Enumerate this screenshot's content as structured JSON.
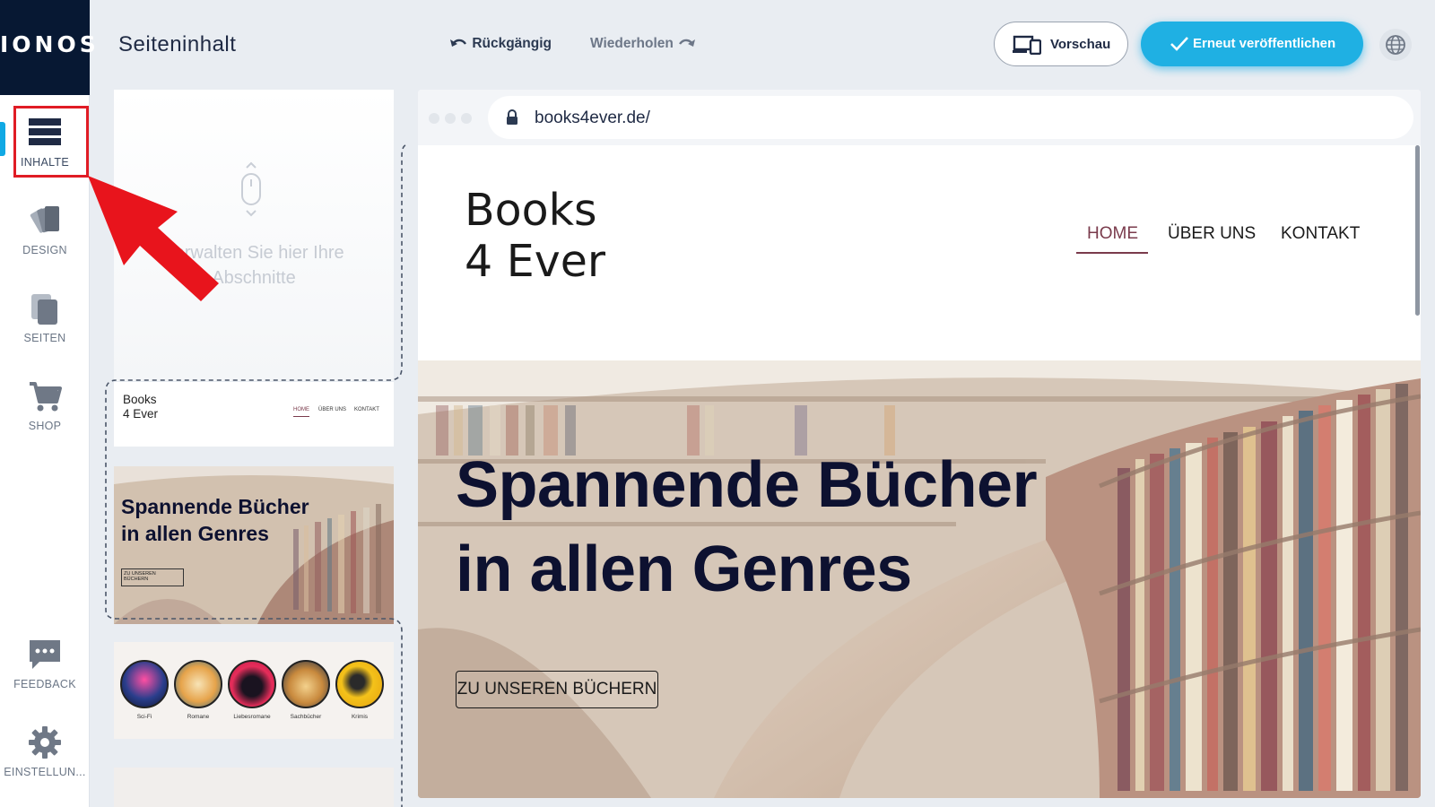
{
  "app": {
    "logo": "IONOS",
    "page_title": "Seiteninhalt",
    "undo_label": "Rückgängig",
    "redo_label": "Wiederholen",
    "preview_label": "Vorschau",
    "publish_label": "Erneut veröffentlichen"
  },
  "sidebar": {
    "items": [
      {
        "label": "INHALTE",
        "icon": "sections-icon",
        "active": true
      },
      {
        "label": "DESIGN",
        "icon": "palette-icon"
      },
      {
        "label": "SEITEN",
        "icon": "pages-icon"
      },
      {
        "label": "SHOP",
        "icon": "cart-icon"
      },
      {
        "label": "FEEDBACK",
        "icon": "chat-icon"
      },
      {
        "label": "EINSTELLUN...",
        "icon": "gear-icon"
      }
    ]
  },
  "sections_panel": {
    "hint": "Verwalten Sie hier Ihre Abschnitte",
    "header_thumb": {
      "title_line1": "Books",
      "title_line2": "4 Ever",
      "nav": [
        "HOME",
        "ÜBER UNS",
        "KONTAKT"
      ]
    },
    "hero_thumb": {
      "title_line1": "Spannende Bücher",
      "title_line2": "in allen Genres",
      "button_line1": "ZU UNSEREN",
      "button_line2": "BÜCHERN"
    },
    "categories": [
      "Sci-Fi",
      "Romane",
      "Liebesromane",
      "Sachbücher",
      "Krimis"
    ]
  },
  "browser": {
    "url": "books4ever.de/"
  },
  "site": {
    "logo_line1": "Books",
    "logo_line2": "4 Ever",
    "nav": {
      "home": "HOME",
      "about": "ÜBER UNS",
      "contact": "KONTAKT"
    },
    "hero_title_line1": "Spannende Bücher",
    "hero_title_line2": "in allen Genres",
    "hero_button": "ZU UNSEREN BÜCHERN"
  },
  "colors": {
    "accent": "#1fb0e3",
    "navy": "#071833",
    "annotation_red": "#e01c25",
    "nav_active": "#7a3b4c"
  }
}
